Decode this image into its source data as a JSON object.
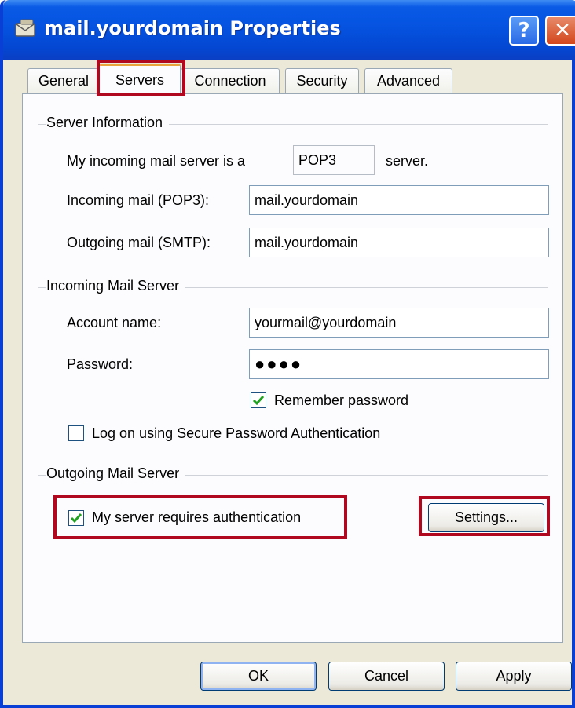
{
  "window": {
    "title": "mail.yourdomain Properties"
  },
  "titlebar": {
    "help_glyph": "?",
    "close_glyph": "✕"
  },
  "tabs": [
    {
      "label": "General",
      "active": false
    },
    {
      "label": "Servers",
      "active": true
    },
    {
      "label": "Connection",
      "active": false
    },
    {
      "label": "Security",
      "active": false
    },
    {
      "label": "Advanced",
      "active": false
    }
  ],
  "server_info": {
    "group_label": "Server Information",
    "incoming_type_prefix": "My incoming mail server is a",
    "incoming_type_value": "POP3",
    "incoming_type_suffix": "server.",
    "incoming_label": "Incoming mail (POP3):",
    "incoming_value": "mail.yourdomain",
    "outgoing_label": "Outgoing mail (SMTP):",
    "outgoing_value": "mail.yourdomain"
  },
  "incoming_server": {
    "group_label": "Incoming Mail Server",
    "account_label": "Account name:",
    "account_value": "yourmail@yourdomain",
    "password_label": "Password:",
    "password_value": "●●●●",
    "remember_label": "Remember password",
    "remember_checked": true,
    "spa_label": "Log on using Secure Password Authentication",
    "spa_checked": false
  },
  "outgoing_server": {
    "group_label": "Outgoing Mail Server",
    "auth_label": "My server requires authentication",
    "auth_checked": true,
    "settings_label": "Settings..."
  },
  "buttons": {
    "ok": "OK",
    "cancel": "Cancel",
    "apply": "Apply"
  },
  "colors": {
    "titlebar": "#0553e0",
    "highlight": "#b0081e",
    "check": "#21a121",
    "dialog_bg": "#ece9d8"
  }
}
